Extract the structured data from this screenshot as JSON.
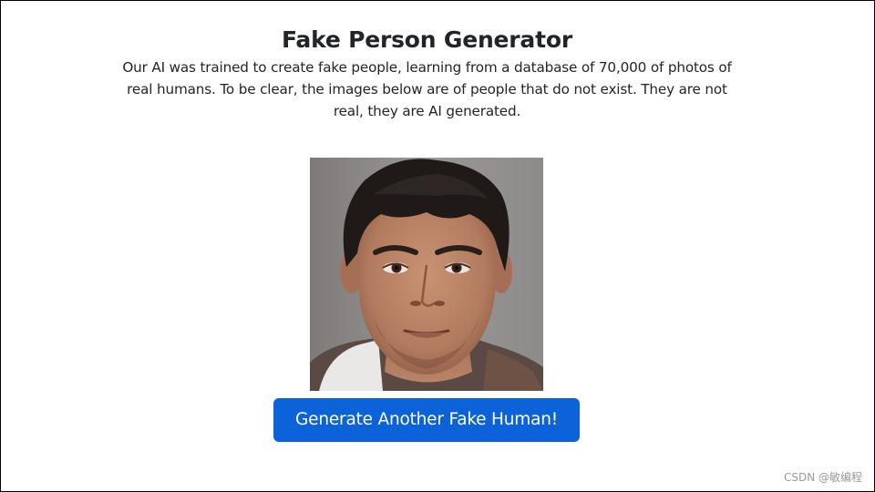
{
  "page": {
    "title": "Fake Person Generator",
    "description": "Our AI was trained to create fake people, learning from a database of 70,000 of photos of real humans. To be clear, the images below are of people that do not exist. They are not real, they are AI generated.",
    "generate_button_label": "Generate Another Fake Human!"
  },
  "watermark": {
    "text": "CSDN @敏编程"
  },
  "colors": {
    "button_bg": "#0b62d9",
    "button_text": "#ffffff",
    "text": "#212529",
    "border": "#000000"
  }
}
